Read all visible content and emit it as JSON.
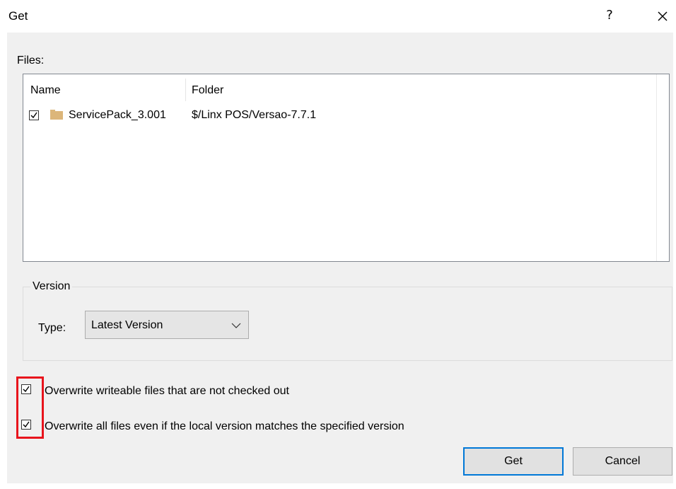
{
  "window": {
    "title": "Get",
    "help_glyph": "?",
    "close_icon": "close-icon"
  },
  "files": {
    "label": "Files:",
    "columns": [
      "Name",
      "Folder"
    ],
    "rows": [
      {
        "checked": true,
        "icon": "folder-icon",
        "name": "ServicePack_3.001",
        "folder": "$/Linx POS/Versao-7.7.1"
      }
    ]
  },
  "version": {
    "group_label": "Version",
    "type_label": "Type:",
    "type_value": "Latest Version"
  },
  "options": [
    {
      "checked": true,
      "label": "Overwrite writeable files that are not checked out"
    },
    {
      "checked": true,
      "label": "Overwrite all files even if the local version matches the specified version"
    }
  ],
  "buttons": {
    "get": "Get",
    "cancel": "Cancel"
  },
  "colors": {
    "highlight": "#e8141c",
    "default_button_border": "#0078d7",
    "folder": "#dcb67a"
  }
}
